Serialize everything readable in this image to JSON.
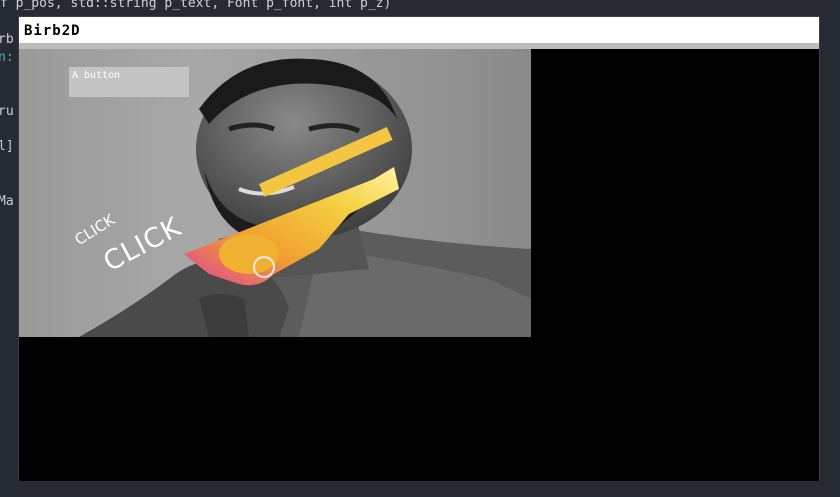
{
  "editor": {
    "top_line": "f p_pos, std::string p_text, Font p_font, int p_z)",
    "fragments": [
      "rb",
      "n:",
      "ru",
      "l]",
      "Ma"
    ]
  },
  "window": {
    "title": "Birb2D"
  },
  "button": {
    "label": "A button"
  },
  "meme": {
    "click_small": "CLICK",
    "click_large": "CLICK"
  }
}
